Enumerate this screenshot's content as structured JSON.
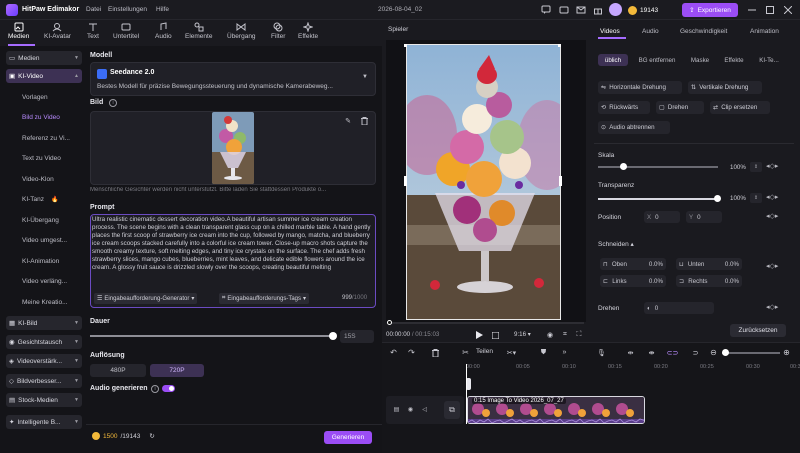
{
  "app": {
    "title": "HitPaw Edimakor",
    "menus": [
      "Datei",
      "Einstellungen",
      "Hilfe"
    ],
    "datetime": "2026-08-04_02",
    "credits": "19143",
    "export_label": "Exportieren",
    "accent": "#9b4df5"
  },
  "toolbar": {
    "tools": [
      "Medien",
      "KI-Avatar",
      "Text",
      "Untertitel",
      "Audio",
      "Elemente",
      "Übergang",
      "Filter",
      "Effekte"
    ],
    "active": "Medien"
  },
  "sidebar": {
    "medien": "Medien",
    "ki_video": "KI-Video",
    "sub": [
      "Vorlagen",
      "Bild zu Video",
      "Referenz zu Vi...",
      "Text zu Video",
      "Video-Klon",
      "KI-Tanz",
      "KI-Übergang",
      "Video umgest...",
      "KI-Animation",
      "Video verläng...",
      "Meine Kreatio..."
    ],
    "active_sub": "Bild zu Video",
    "ki_bild": "KI-Bild",
    "gesicht": "Gesichtstausch",
    "videoverst": "Videoverstärk...",
    "bildverb": "Bildverbesser...",
    "stock": "Stock-Medien",
    "intelligent": "Intelligente B..."
  },
  "panel": {
    "model_label": "Modell",
    "model_name": "Seedance 2.0",
    "model_desc": "Bestes Modell für präzise Bewegungssteuerung und dynamische Kamerabeweg...",
    "image_label": "Bild",
    "image_note": "Menschliche Gesichter werden nicht unterstützt. Bitte laden Sie stattdessen Produkte o...",
    "prompt_label": "Prompt",
    "prompt_text": "Ultra realistic cinematic dessert decoration video.A beautiful artisan summer ice cream creation process. The scene begins with a clean transparent glass cup on a chilled marble table. A hand gently places the first scoop of strawberry ice cream into the cup, followed by mango, matcha, and blueberry ice cream scoops stacked carefully into a colorful ice cream tower. Close-up macro shots capture the smooth creamy texture, soft melting edges, and tiny ice crystals on the surface. The chef  adds fresh strawberry slices, mango cubes, blueberries, mint leaves, and delicate edible flowers around the ice cream. A glossy fruit sauce is drizzled slowly over the scoops, creating beautiful melting",
    "prompt_gen": "Eingabeaufforderung-Generator",
    "prompt_tags": "Eingabeaufforderungs-Tags",
    "char_count": "999",
    "char_max": "/1000",
    "duration_label": "Dauer",
    "duration_value": "15S",
    "resolution_label": "Auflösung",
    "res_options": [
      "480P",
      "720P"
    ],
    "res_selected": "720P",
    "audio_label": "Audio generieren",
    "audio_on": true,
    "gen_credits": "1500",
    "gen_total": "/19143",
    "generate_label": "Generieren"
  },
  "player": {
    "title": "Spieler",
    "time_current": "00:00:00",
    "time_total": "00:15:03",
    "ratio": "9:16"
  },
  "right": {
    "tabs": [
      "Videos",
      "Audio",
      "Geschwindigkeit",
      "Animation"
    ],
    "active_tab": "Videos",
    "subtabs": [
      "üblich",
      "BG entfernen",
      "Maske",
      "Effekte",
      "KI-Te..."
    ],
    "active_subtab": "üblich",
    "actions": [
      "Horizontale Drehung",
      "Vertikale Drehung",
      "Rückwärts",
      "Drehen",
      "Clip ersetzen",
      "Audio abtrennen"
    ],
    "scale_label": "Skala",
    "scale_value": "100%",
    "scale_fraction": 1.0,
    "opacity_label": "Transparenz",
    "opacity_value": "100%",
    "opacity_fraction": 1.0,
    "position_label": "Position",
    "pos_x_label": "X",
    "pos_x": "0",
    "pos_y_label": "Y",
    "pos_y": "0",
    "crop_label": "Schneiden",
    "crop_fields": [
      {
        "label": "Oben",
        "value": "0.0%"
      },
      {
        "label": "Unten",
        "value": "0.0%"
      },
      {
        "label": "Links",
        "value": "0.0%"
      },
      {
        "label": "Rechts",
        "value": "0.0%"
      }
    ],
    "rotate_label": "Drehen",
    "rotate_value": "0",
    "reset_label": "Zurücksetzen"
  },
  "timeline": {
    "cut_label": "Teilen",
    "ruler": [
      "00:00",
      "00:05",
      "00:10",
      "00:15",
      "00:20",
      "00:25",
      "00:30",
      "00:35"
    ],
    "clip_label": "0:15 Image To Video 2026_07_27"
  }
}
